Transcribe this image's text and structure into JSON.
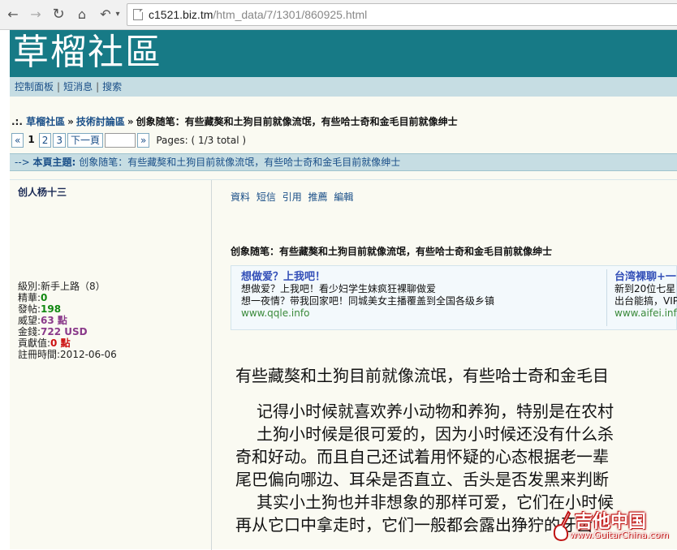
{
  "browser": {
    "back_icon": "back-arrow-icon",
    "forward_icon": "forward-arrow-icon",
    "reload_icon": "reload-icon",
    "home_icon": "home-icon",
    "url_host": "c1521.biz.tm",
    "url_path": "/htm_data/7/1301/860925.html"
  },
  "site": {
    "title": "草榴社區"
  },
  "topnav": {
    "items": [
      "控制面板",
      "短消息",
      "搜索"
    ]
  },
  "breadcrumb": {
    "prefix": ".:.",
    "home": "草榴社區",
    "forum": "技術討論區",
    "current": "创象随笔：有些藏獒和土狗目前就像流氓，有些哈士奇和金毛目前就像绅士",
    "sep": "»"
  },
  "pager": {
    "first": "«",
    "pages": [
      "1",
      "2",
      "3"
    ],
    "next": "下一頁",
    "last": "»",
    "info": "Pages: ( 1/3 total )"
  },
  "topic_bar": {
    "arrow": "-->",
    "label": "本頁主題:",
    "title": "创象随笔：有些藏獒和土狗目前就像流氓，有些哈士奇和金毛目前就像绅士"
  },
  "author": {
    "name": "创人杨十三",
    "level_label": "級別:",
    "level_value": "新手上路（8）",
    "elite_label": "精華:",
    "elite_value": "0",
    "posts_label": "發帖:",
    "posts_value": "198",
    "prestige_label": "威望:",
    "prestige_value": "63 點",
    "money_label": "金錢:",
    "money_value": "722 USD",
    "contrib_label": "貢獻值:",
    "contrib_value": "0 點",
    "reg_label": "註冊時間:",
    "reg_value": "2012-06-06"
  },
  "post": {
    "actions": [
      "資料",
      "短信",
      "引用",
      "推薦",
      "編輯"
    ],
    "title": "创象随笔：有些藏獒和土狗目前就像流氓，有些哈士奇和金毛目前就像绅士",
    "ad1": {
      "title": "想做爱？上我吧！",
      "line1": "想做爱？上我吧！看少妇学生妹疯狂裸聊做爱",
      "line2": "想一夜情？带我回家吧！同城美女主播覆盖到全国各级乡镇",
      "url": "www.qqle.info"
    },
    "ad2": {
      "title": "台湾裸聊+一",
      "line1": "新到20位七星",
      "line2": "出台能搞，VIP",
      "url": "www.aifei.info"
    },
    "body": [
      "有些藏獒和土狗目前就像流氓，有些哈士奇和金毛目",
      "记得小时候就喜欢养小动物和养狗，特别是在农村",
      "土狗小时候是很可爱的，因为小时候还没有什么杀",
      "奇和好动。而且自己还试着用怀疑的心态根据老一辈",
      "尾巴偏向哪边、耳朵是否直立、舌头是否发黑来判断",
      "其实小土狗也并非想象的那样可爱，它们在小时候",
      "再从它口中拿走时，它们一般都会露出狰狞的牙齿"
    ]
  },
  "watermark": {
    "text": "吉他中国",
    "sub": "www.GuitarChina.com"
  },
  "colors": {
    "header_bg": "#177a86",
    "nav_bg": "#c6dde3",
    "content_bg": "#fafaf2",
    "link": "#1a4f88"
  }
}
